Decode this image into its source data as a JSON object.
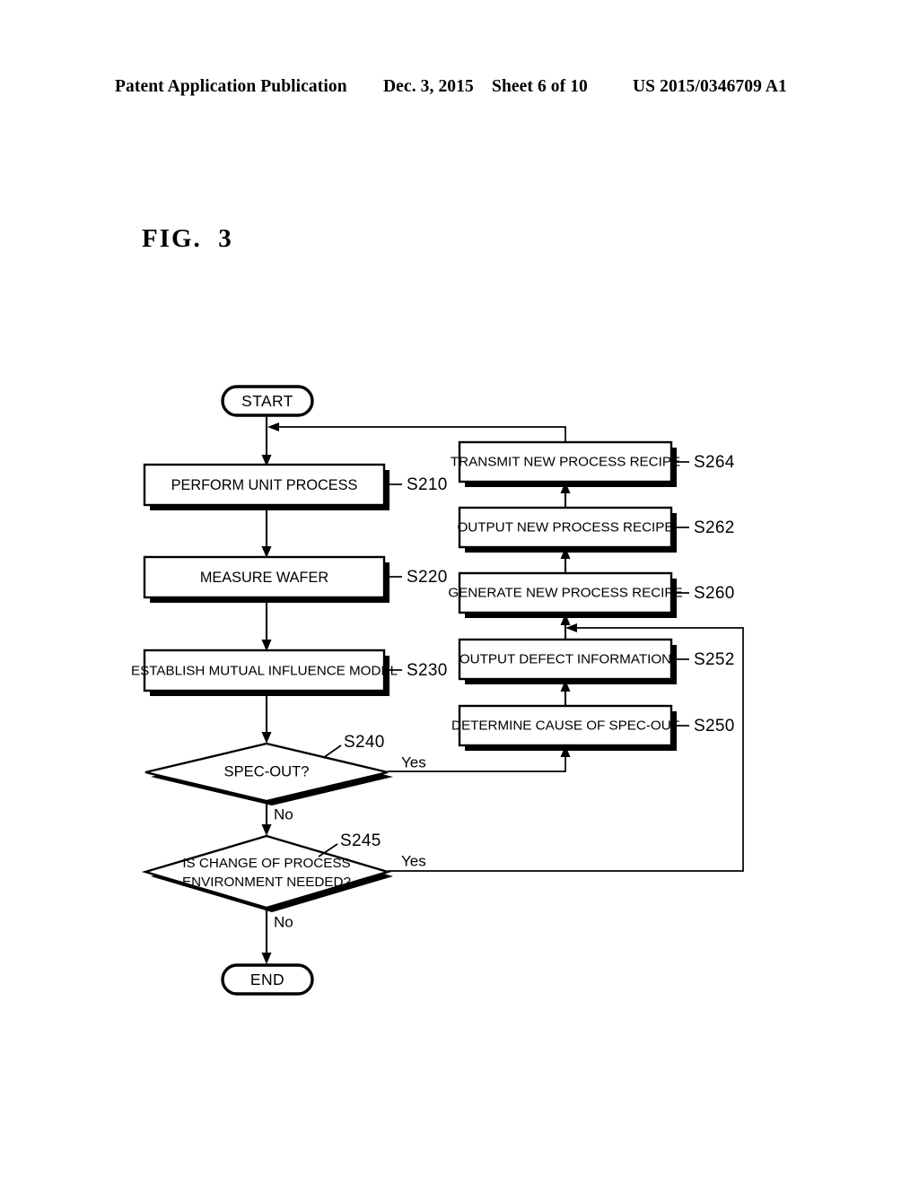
{
  "header": {
    "publication": "Patent Application Publication",
    "date": "Dec. 3, 2015",
    "sheet": "Sheet 6 of 10",
    "number": "US 2015/0346709 A1"
  },
  "figure": {
    "label": "FIG.  3",
    "title_prefix": "FIG.",
    "title_number": "3"
  },
  "flowchart": {
    "terminators": {
      "start": "START",
      "end": "END"
    },
    "process_steps": [
      {
        "id": "S210",
        "label": "PERFORM UNIT PROCESS",
        "ref": "S210"
      },
      {
        "id": "S220",
        "label": "MEASURE WAFER",
        "ref": "S220"
      },
      {
        "id": "S230",
        "label": "ESTABLISH MUTUAL INFLUENCE MODEL",
        "ref": "S230"
      },
      {
        "id": "S250",
        "label": "DETERMINE CAUSE OF SPEC-OUT",
        "ref": "S250"
      },
      {
        "id": "S252",
        "label": "OUTPUT DEFECT INFORMATION",
        "ref": "S252"
      },
      {
        "id": "S260",
        "label": "GENERATE NEW PROCESS RECIPE",
        "ref": "S260"
      },
      {
        "id": "S262",
        "label": "OUTPUT NEW PROCESS RECIPE",
        "ref": "S262"
      },
      {
        "id": "S264",
        "label": "TRANSMIT NEW PROCESS RECIPE",
        "ref": "S264"
      }
    ],
    "decisions": [
      {
        "id": "S240",
        "label_line1": "SPEC-OUT?",
        "label_line2": "",
        "ref": "S240",
        "yes_label": "Yes",
        "no_label": "No"
      },
      {
        "id": "S245",
        "label_line1": "IS CHANGE OF PROCESS",
        "label_line2": "ENVIRONMENT NEEDED?",
        "ref": "S245",
        "yes_label": "Yes",
        "no_label": "No"
      }
    ],
    "colors": {
      "ink": "#000000",
      "paper": "#ffffff"
    }
  }
}
